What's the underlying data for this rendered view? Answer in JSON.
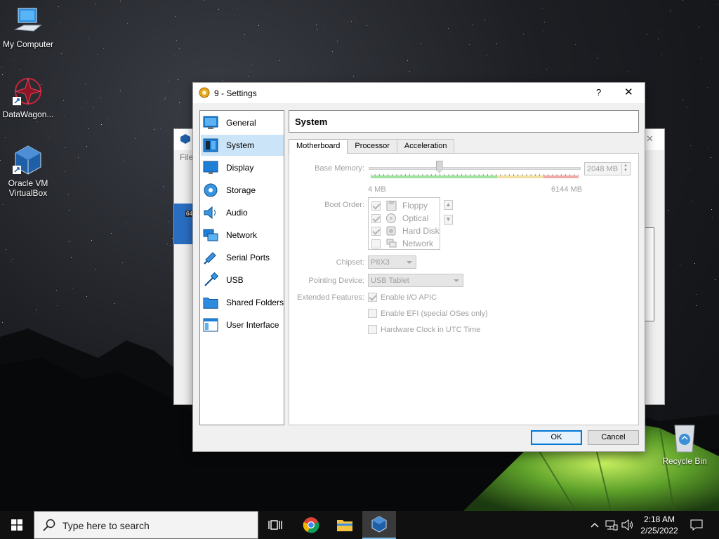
{
  "desktop": {
    "icons": [
      {
        "label": "My Computer"
      },
      {
        "label": "DataWagon..."
      },
      {
        "label": "Oracle VM VirtualBox"
      },
      {
        "label": "Recycle Bin"
      }
    ]
  },
  "background_window": {
    "menu_fragment": "File",
    "badge": "64"
  },
  "dialog": {
    "title": "9 - Settings",
    "help": "?",
    "close": "✕",
    "nav": [
      {
        "label": "General",
        "icon": "general-icon"
      },
      {
        "label": "System",
        "icon": "system-icon",
        "selected": true
      },
      {
        "label": "Display",
        "icon": "display-icon"
      },
      {
        "label": "Storage",
        "icon": "storage-icon"
      },
      {
        "label": "Audio",
        "icon": "audio-icon"
      },
      {
        "label": "Network",
        "icon": "network-icon"
      },
      {
        "label": "Serial Ports",
        "icon": "serial-ports-icon"
      },
      {
        "label": "USB",
        "icon": "usb-icon"
      },
      {
        "label": "Shared Folders",
        "icon": "shared-folders-icon"
      },
      {
        "label": "User Interface",
        "icon": "user-interface-icon"
      }
    ],
    "section_title": "System",
    "tabs": [
      "Motherboard",
      "Processor",
      "Acceleration"
    ],
    "active_tab": "Motherboard",
    "motherboard": {
      "base_memory_label": "Base Memory:",
      "base_memory_value": "2048 MB",
      "memory_min": "4 MB",
      "memory_max": "6144 MB",
      "memory_fraction": 0.333,
      "boot_order_label": "Boot Order:",
      "boot_items": [
        {
          "label": "Floppy",
          "checked": true,
          "icon": "floppy-icon"
        },
        {
          "label": "Optical",
          "checked": true,
          "icon": "optical-icon"
        },
        {
          "label": "Hard Disk",
          "checked": true,
          "icon": "hard-disk-icon"
        },
        {
          "label": "Network",
          "checked": false,
          "icon": "network-boot-icon"
        }
      ],
      "chipset_label": "Chipset:",
      "chipset_value": "PIIX3",
      "pointing_label": "Pointing Device:",
      "pointing_value": "USB Tablet",
      "extended_label": "Extended Features:",
      "features": [
        {
          "label": "Enable I/O APIC",
          "checked": true
        },
        {
          "label": "Enable EFI (special OSes only)",
          "checked": false
        },
        {
          "label": "Hardware Clock in UTC Time",
          "checked": false
        }
      ]
    },
    "ok_label": "OK",
    "cancel_label": "Cancel"
  },
  "taskbar": {
    "search_placeholder": "Type here to search",
    "time": "2:18 AM",
    "date": "2/25/2022"
  },
  "colors": {
    "selection": "#cce4f7",
    "accent": "#0078d7",
    "taskbar": "#101010"
  }
}
